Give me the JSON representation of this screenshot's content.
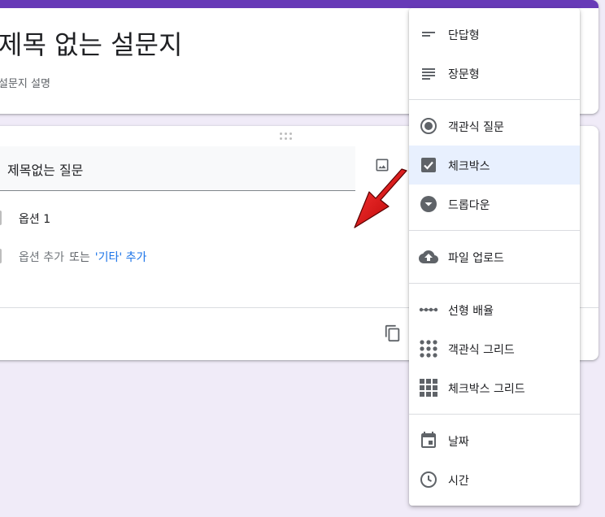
{
  "form": {
    "title": "제목 없는 설문지",
    "description": "설문지 설명"
  },
  "question": {
    "title": "제목없는 질문",
    "options": [
      {
        "label": "옵션 1"
      }
    ],
    "add_option": "옵션 추가",
    "or_text": "또는",
    "add_other": "'기타' 추가"
  },
  "menu": {
    "items": [
      {
        "label": "단답형",
        "icon": "short-answer-icon"
      },
      {
        "label": "장문형",
        "icon": "paragraph-icon"
      },
      {
        "label": "객관식 질문",
        "icon": "radio-button-icon"
      },
      {
        "label": "체크박스",
        "icon": "checkbox-icon",
        "selected": true
      },
      {
        "label": "드롭다운",
        "icon": "dropdown-icon"
      },
      {
        "label": "파일 업로드",
        "icon": "cloud-upload-icon"
      },
      {
        "label": "선형 배율",
        "icon": "linear-scale-icon"
      },
      {
        "label": "객관식 그리드",
        "icon": "dot-grid-icon"
      },
      {
        "label": "체크박스 그리드",
        "icon": "checkbox-grid-icon"
      },
      {
        "label": "날짜",
        "icon": "calendar-icon"
      },
      {
        "label": "시간",
        "icon": "clock-icon"
      }
    ]
  },
  "colors": {
    "accent": "#673ab7",
    "link": "#1a73e8",
    "selected_bg": "#e8f0fe",
    "background": "#f0ebf8",
    "arrow": "#e01b1b"
  }
}
